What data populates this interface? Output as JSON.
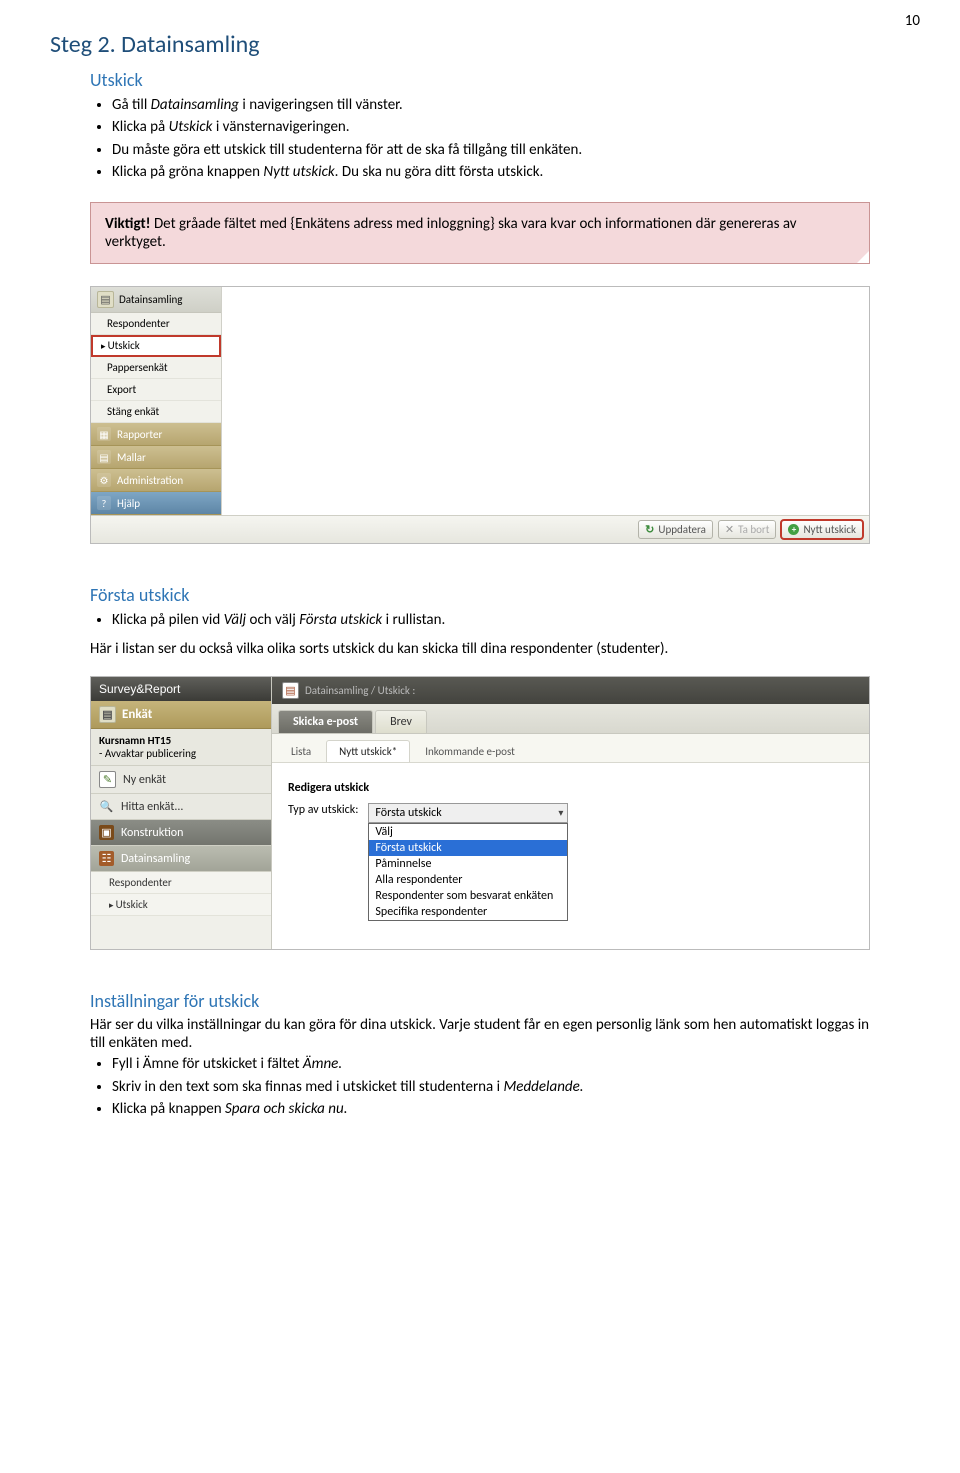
{
  "pagenum": "10",
  "h1": "Steg 2. Datainsamling",
  "s1": {
    "title": "Utskick",
    "b1a": "Gå till ",
    "b1b": "Datainsamling",
    "b1c": " i navigeringsen till vänster.",
    "b2a": "Klicka på ",
    "b2b": "Utskick",
    "b2c": " i vänsternavigeringen.",
    "b3": "Du måste göra ett utskick till studenterna för att de ska få tillgång till enkäten.",
    "b4a": "Klicka på gröna knappen ",
    "b4b": "Nytt utskick",
    "b4c": ". Du ska nu göra ditt första utskick."
  },
  "callout": {
    "lead": "Viktigt!",
    "rest": " Det gråade fältet med {Enkätens adress med inloggning} ska vara kvar och informationen där genereras av verktyget."
  },
  "shot1": {
    "head": "Datainsamling",
    "items": [
      "Respondenter",
      "Utskick",
      "Pappersenkät",
      "Export",
      "Stäng enkät"
    ],
    "bands": {
      "rapporter": "Rapporter",
      "mallar": "Mallar",
      "admin": "Administration",
      "hjalp": "Hjälp"
    },
    "btns": {
      "uppdatera": "Uppdatera",
      "tabort": "Ta bort",
      "nytt": "Nytt utskick"
    }
  },
  "s2": {
    "title": "Första utskick",
    "b1a": "Klicka på pilen vid ",
    "b1b": "Välj",
    "b1c": " och välj ",
    "b1d": "Första utskick",
    "b1e": " i rullistan.",
    "p": "Här i listan ser du också vilka olika sorts utskick du kan skicka till dina respondenter (studenter)."
  },
  "shot2": {
    "brand": "Survey&Report",
    "enkat": "Enkät",
    "kursnamn_a": "Kursnamn HT15",
    "kursnamn_b": "- Avvaktar publicering",
    "left": {
      "ny": "Ny enkät",
      "hitta": "Hitta enkät...",
      "konstr": "Konstruktion",
      "datains": "Datainsamling",
      "resp": "Respondenter",
      "utskick": "Utskick"
    },
    "crumb": "Datainsamling / Utskick :",
    "tabs": {
      "epost": "Skicka e-post",
      "brev": "Brev"
    },
    "subtabs": {
      "lista": "Lista",
      "nytt": "Nytt utskick*",
      "inkom": "Inkommande e-post"
    },
    "form": {
      "title": "Redigera utskick",
      "label": "Typ av utskick:",
      "selected": "Första utskick"
    },
    "dd": [
      "Välj",
      "Första utskick",
      "Påminnelse",
      "Alla respondenter",
      "Respondenter som besvarat enkäten",
      "Specifika respondenter"
    ]
  },
  "s3": {
    "title": "Inställningar för utskick",
    "p": "Här ser du vilka inställningar du kan göra för dina utskick. Varje student får en egen personlig länk som hen automatiskt loggas in till enkäten med.",
    "b1a": "Fyll i Ämne för utskicket i fältet ",
    "b1b": "Ämne.",
    "b2a": "Skriv in den text som ska finnas med i utskicket till studenterna i ",
    "b2b": "Meddelande.",
    "b3a": "Klicka på knappen ",
    "b3b": "Spara och skicka nu."
  }
}
